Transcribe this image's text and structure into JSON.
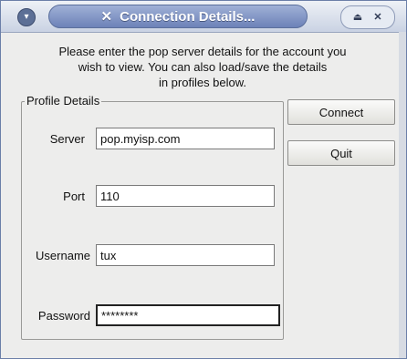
{
  "window": {
    "title": "Connection Details...",
    "icons": {
      "menu": "chevron-down-icon",
      "title": "x-logo-icon",
      "shade": "eject-icon",
      "close": "close-icon"
    }
  },
  "intro": {
    "line1": "Please enter the pop server details for the account you",
    "line2": "wish to view. You can also load/save the details",
    "line3": "in profiles below."
  },
  "profile": {
    "legend": "Profile Details",
    "server": {
      "label": "Server",
      "value": "pop.myisp.com"
    },
    "port": {
      "label": "Port",
      "value": "110"
    },
    "username": {
      "label": "Username",
      "value": "tux"
    },
    "password": {
      "label": "Password",
      "value": "********"
    }
  },
  "buttons": {
    "connect": "Connect",
    "quit": "Quit"
  }
}
